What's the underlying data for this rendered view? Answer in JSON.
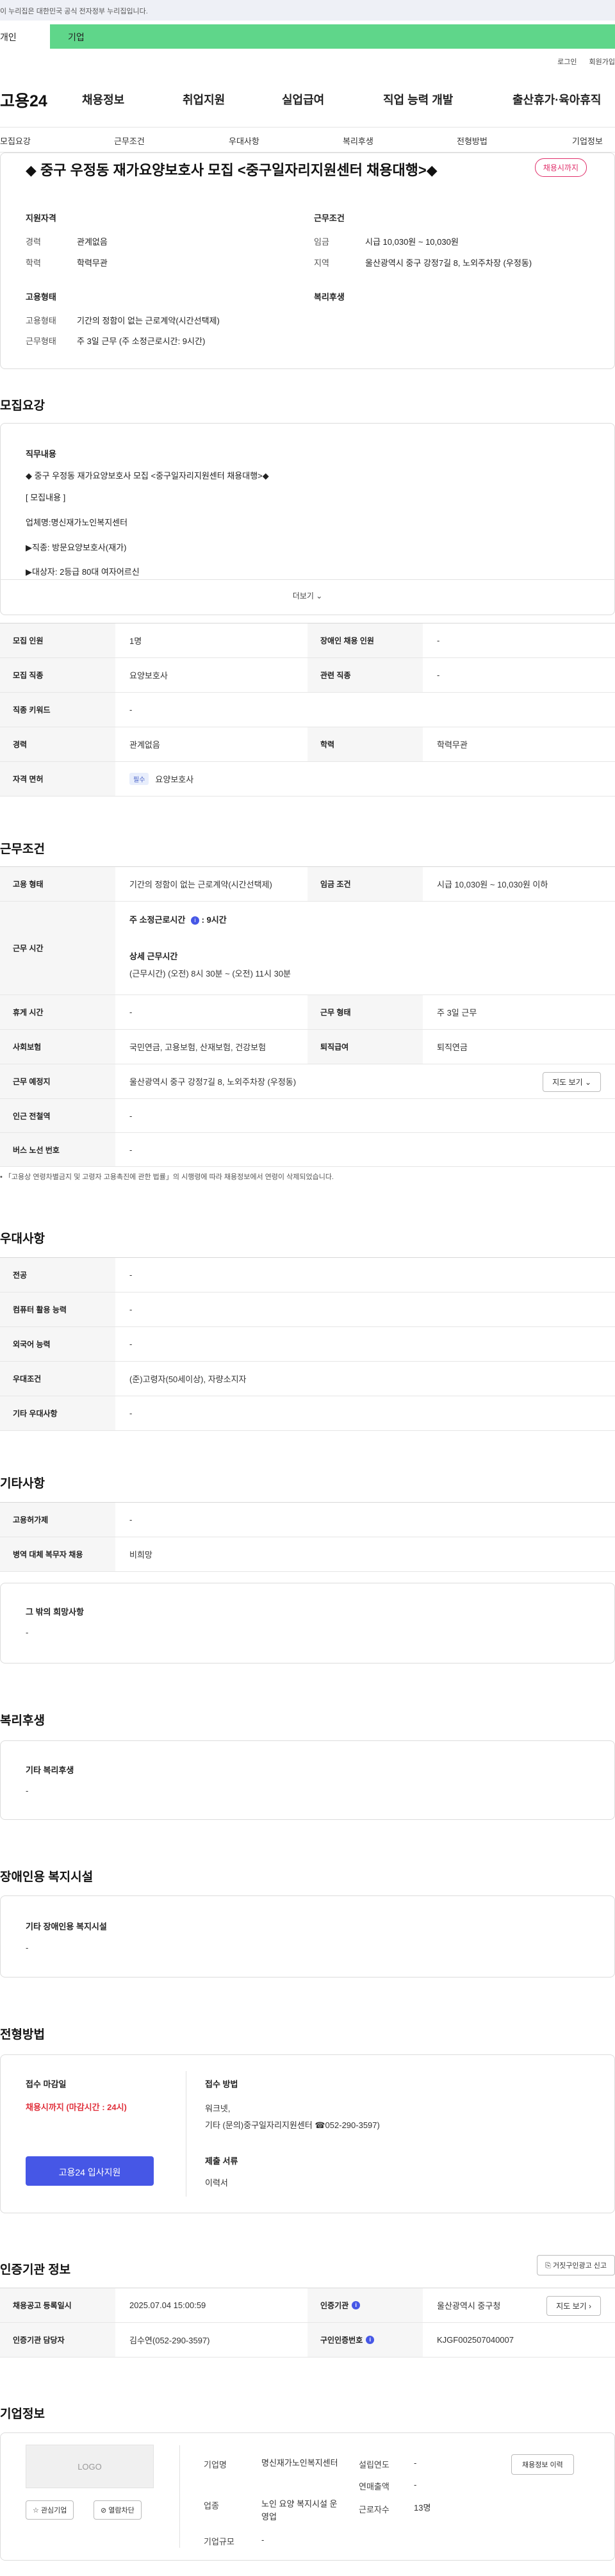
{
  "gov_banner": "이 누리집은 대한민국 공식 전자정부 누리집입니다.",
  "user_tabs": {
    "personal": "개인",
    "company": "기업"
  },
  "util_links": [
    "로그인",
    "회원가입"
  ],
  "site": {
    "logo": "고용24"
  },
  "gnb": [
    "채용정보",
    "취업지원",
    "실업급여",
    "직업 능력 개발",
    "출산휴가·육아휴직"
  ],
  "lnb": [
    "모집요강",
    "근무조건",
    "우대사항",
    "복리후생",
    "전형방법",
    "기업정보"
  ],
  "job": {
    "title": "◆ 중구 우정동 재가요양보호사 모집 <중구일자리지원센터 채용대행>◆",
    "status_badge": "채용시까지",
    "summary": {
      "qual_head": "지원자격",
      "career_label": "경력",
      "career_value": "관계없음",
      "edu_label": "학력",
      "edu_value": "학력무관",
      "cond_head": "근무조건",
      "wage_label": "임금",
      "wage_value": "시급 10,030원 ~ 10,030원",
      "area_label": "지역",
      "area_value": "울산광역시 중구 강정7길 8, 노외주차장 (우정동)",
      "emp_head": "고용형태",
      "emp_label": "고용형태",
      "emp_value": "기간의 정함이 없는 근로계약(시간선택제)",
      "work_label": "근무형태",
      "work_value": "주 3일 근무 (주 소정근로시간: 9시간)",
      "welfare_head": "복리후생"
    }
  },
  "recruit": {
    "title": "모집요강",
    "duty_head": "직무내용",
    "duty_lines": [
      "◆ 중구 우정동 재가요양보호사 모집 <중구일자리지원센터 채용대행>◆",
      "[ 모집내용 ]",
      "업체명:명신재가노인복지센터",
      "▶직종: 방문요양보호사(재가)",
      "▶대상자: 2등급 80대 여자어르신"
    ],
    "more": "더보기",
    "rows": {
      "count_label": "모집 인원",
      "count_value": "1명",
      "disabled_label": "장애인 채용 인원",
      "disabled_value": "-",
      "job_label": "모집 직종",
      "job_value": "요양보호사",
      "related_label": "관련 직종",
      "related_value": "-",
      "keyword_label": "직종 키워드",
      "keyword_value": "-",
      "career_label": "경력",
      "career_value": "관계없음",
      "edu_label": "학력",
      "edu_value": "학력무관",
      "license_label": "자격 면허",
      "license_tag": "필수",
      "license_value": "요양보호사"
    }
  },
  "conditions": {
    "title": "근무조건",
    "emp_label": "고용 형태",
    "emp_value": "기간의 정함이 없는 근로계약(시간선택제)",
    "wage_label": "임금 조건",
    "wage_value": "시급 10,030원 ~ 10,030원 이하",
    "hours_label": "근무 시간",
    "hours_main": "주 소정근로시간",
    "hours_main_value": ": 9시간",
    "hours_detail_head": "상세 근무시간",
    "hours_detail": "(근무시간) (오전) 8시 30분 ~ (오전) 11시 30분",
    "rest_label": "휴게 시간",
    "rest_value": "-",
    "worktype_label": "근무 형태",
    "worktype_value": "주 3일 근무",
    "insurance_label": "사회보험",
    "insurance_value": "국민연금, 고용보험, 산재보험, 건강보험",
    "retire_label": "퇴직급여",
    "retire_value": "퇴직연금",
    "place_label": "근무 예정지",
    "place_value": "울산광역시 중구 강정7길 8, 노외주차장 (우정동)",
    "map_btn": "지도 보기",
    "subway_label": "인근 전철역",
    "subway_value": "-",
    "bus_label": "버스 노선 번호",
    "bus_value": "-",
    "note": "「고용상 연령차별금지 및 고령자 고용촉진에 관한 법률」의 시행령에 따라 채용정보에서 연령이 삭제되었습니다."
  },
  "preferences": {
    "title": "우대사항",
    "major_label": "전공",
    "major_value": "-",
    "pc_label": "컴퓨터 활용 능력",
    "pc_value": "-",
    "lang_label": "외국어 능력",
    "lang_value": "-",
    "cond_label": "우대조건",
    "cond_value": "(준)고령자(50세이상), 자량소지자",
    "etc_label": "기타 우대사항",
    "etc_value": "-"
  },
  "others": {
    "title": "기타사항",
    "device_label": "고용허가제",
    "device_value": "-",
    "military_label": "병역 대체 복무자 채용",
    "military_value": "비희망",
    "wish_head": "그 밖의 희망사항",
    "wish_value": "-"
  },
  "welfare": {
    "title": "복리후생",
    "head": "기타 복리후생",
    "value": "-"
  },
  "disabled_facility": {
    "title": "장애인용 복지시설",
    "head": "기타 장애인용 복지시설",
    "value": "-"
  },
  "process": {
    "title": "전형방법",
    "deadline_head": "접수 마감일",
    "deadline_value": "채용시까지 (마감시간 : 24시)",
    "method_head": "접수 방법",
    "method_line1": "워크넷,",
    "method_line2": "기타 (문의)중구일자리지원센터 ☎052-290-3597)",
    "docs_head": "제출 서류",
    "docs_value": "이력서",
    "apply_btn": "고용24 입사지원"
  },
  "cert": {
    "title": "인증기관 정보",
    "report_btn": "거짓구인광고 신고",
    "reg_label": "채용공고 등록일시",
    "reg_value": "2025.07.04 15:00:59",
    "org_label": "인증기관",
    "org_value": "울산광역시 중구청",
    "map_btn": "지도 보기",
    "manager_label": "인증기관 담당자",
    "manager_value": "김수연(052-290-3597)",
    "reqno_label": "구인인증번호",
    "reqno_value": "KJGF002507040007"
  },
  "company": {
    "title": "기업정보",
    "logo_text": "LOGO",
    "fav_btn": "관심기업",
    "block_btn": "열람차단",
    "history_btn": "채용정보 이력",
    "name_label": "기업명",
    "name_value": "명신재가노인복지센터",
    "founded_label": "설립연도",
    "founded_value": "-",
    "sales_label": "연매출액",
    "sales_value": "-",
    "industry_label": "업종",
    "industry_value": "노인 요양 복지시설 운영업",
    "emp_label": "근로자수",
    "emp_value": "13명",
    "scale_label": "기업규모",
    "scale_value": "-"
  }
}
